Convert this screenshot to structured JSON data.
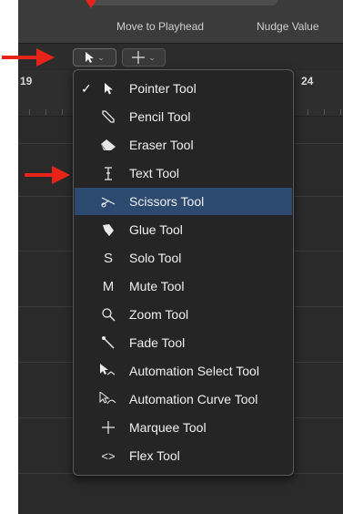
{
  "toolbar": {
    "move_to_playhead": "Move to Playhead",
    "nudge_value": "Nudge Value"
  },
  "ruler": {
    "bar_start": "19",
    "bar_end": "24"
  },
  "tool_menu": {
    "checked": "✓",
    "items": [
      {
        "label": "Pointer Tool",
        "icon": "pointer-icon",
        "checked": true
      },
      {
        "label": "Pencil Tool",
        "icon": "pencil-icon"
      },
      {
        "label": "Eraser Tool",
        "icon": "eraser-icon"
      },
      {
        "label": "Text Tool",
        "icon": "text-cursor-icon"
      },
      {
        "label": "Scissors Tool",
        "icon": "scissors-icon",
        "highlighted": true
      },
      {
        "label": "Glue Tool",
        "icon": "glue-icon"
      },
      {
        "label": "Solo Tool",
        "icon": "solo-icon",
        "glyph": "S"
      },
      {
        "label": "Mute Tool",
        "icon": "mute-icon",
        "glyph": "M"
      },
      {
        "label": "Zoom Tool",
        "icon": "zoom-icon"
      },
      {
        "label": "Fade Tool",
        "icon": "fade-icon"
      },
      {
        "label": "Automation Select Tool",
        "icon": "automation-select-icon"
      },
      {
        "label": "Automation Curve Tool",
        "icon": "automation-curve-icon"
      },
      {
        "label": "Marquee Tool",
        "icon": "marquee-icon"
      },
      {
        "label": "Flex Tool",
        "icon": "flex-icon",
        "glyph": "<>"
      }
    ]
  },
  "colors": {
    "highlight": "#2c4a70",
    "annotation_arrow": "#e8231a"
  }
}
